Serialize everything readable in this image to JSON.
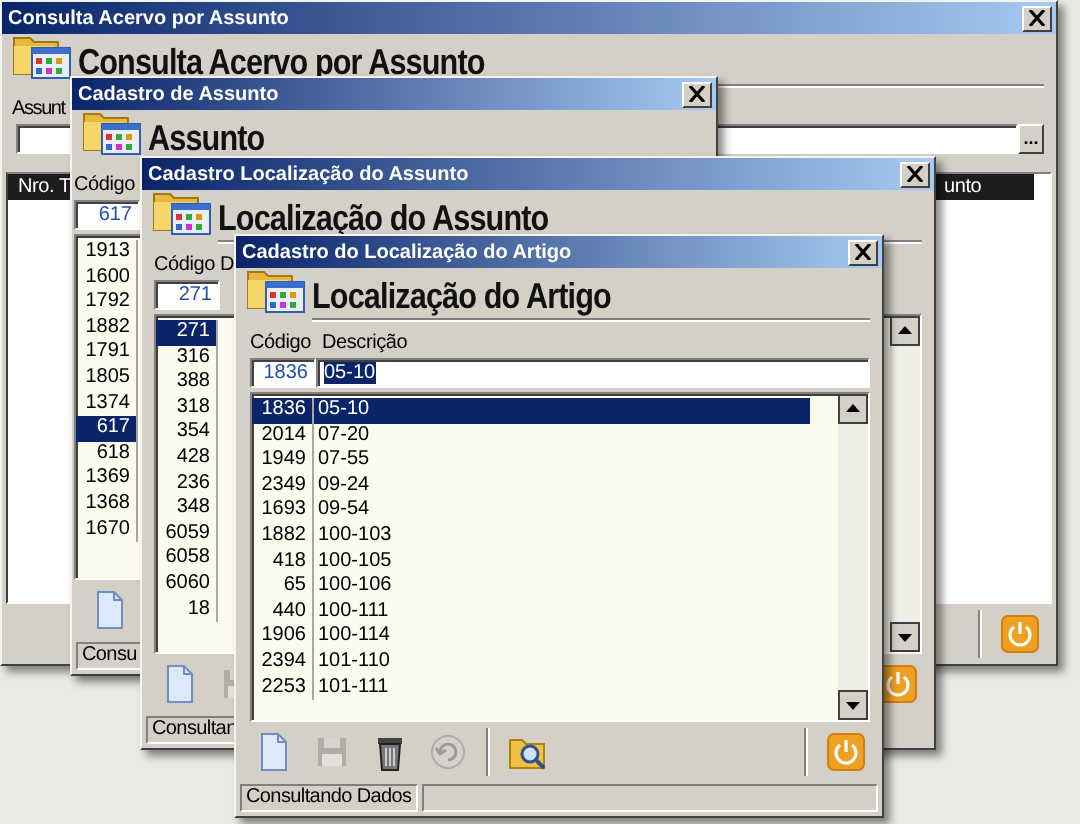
{
  "windows": [
    {
      "kind": "search",
      "title": "Consulta Acervo por Assunto",
      "heading": "Consulta Acervo por Assunto",
      "field_label": "Assunt",
      "ellipsis_button": "...",
      "grid_columns": [
        "Nro. T",
        "unto"
      ],
      "toolbar": {
        "end": [
          {
            "kind": "exit",
            "disabled": false
          }
        ]
      }
    },
    {
      "kind": "list",
      "title": "Cadastro de Assunto",
      "heading": "Assunto",
      "code_label": "Código",
      "code_value": "617",
      "rows": [
        {
          "code": "1913",
          "selected": false
        },
        {
          "code": "1600",
          "selected": false
        },
        {
          "code": "1792",
          "selected": false
        },
        {
          "code": "1882",
          "selected": false
        },
        {
          "code": "1791",
          "selected": false
        },
        {
          "code": "1805",
          "selected": false
        },
        {
          "code": "1374",
          "selected": false
        },
        {
          "code": "617",
          "selected": true
        },
        {
          "code": "618",
          "selected": false
        },
        {
          "code": "1369",
          "selected": false
        },
        {
          "code": "1368",
          "selected": false
        },
        {
          "code": "1670",
          "selected": false
        }
      ],
      "toolbar": {
        "start": [
          [
            {
              "kind": "new",
              "disabled": false
            }
          ]
        ]
      },
      "status": "Consu"
    },
    {
      "kind": "list",
      "title": "Cadastro Localização do Assunto",
      "heading": "Localização do Assunto",
      "code_label": "Código",
      "desc_label": "D",
      "code_value": "271",
      "rows": [
        {
          "code": "271",
          "selected": true
        },
        {
          "code": "316",
          "selected": false
        },
        {
          "code": "388",
          "selected": false
        },
        {
          "code": "318",
          "selected": false
        },
        {
          "code": "354",
          "selected": false
        },
        {
          "code": "428",
          "selected": false
        },
        {
          "code": "236",
          "selected": false
        },
        {
          "code": "348",
          "selected": false
        },
        {
          "code": "6059",
          "selected": false
        },
        {
          "code": "6058",
          "selected": false
        },
        {
          "code": "6060",
          "selected": false
        },
        {
          "code": "18",
          "selected": false
        }
      ],
      "toolbar": {
        "start": [
          [
            {
              "kind": "new",
              "disabled": false
            },
            {
              "kind": "save",
              "disabled": true
            }
          ]
        ],
        "end": [
          {
            "kind": "exit",
            "disabled": false
          }
        ]
      },
      "status": "Consultan"
    },
    {
      "kind": "detail",
      "title": "Cadastro do Localização do Artigo",
      "heading": "Localização do Artigo",
      "code_label": "Código",
      "desc_label": "Descrição",
      "code_value": "1836",
      "desc_value": "05-10",
      "rows": [
        {
          "code": "1836",
          "desc": "05-10",
          "selected": true
        },
        {
          "code": "2014",
          "desc": "07-20",
          "selected": false
        },
        {
          "code": "1949",
          "desc": "07-55",
          "selected": false
        },
        {
          "code": "2349",
          "desc": "09-24",
          "selected": false
        },
        {
          "code": "1693",
          "desc": "09-54",
          "selected": false
        },
        {
          "code": "1882",
          "desc": "100-103",
          "selected": false
        },
        {
          "code": "418",
          "desc": "100-105",
          "selected": false
        },
        {
          "code": "65",
          "desc": "100-106",
          "selected": false
        },
        {
          "code": "440",
          "desc": "100-111",
          "selected": false
        },
        {
          "code": "1906",
          "desc": "100-114",
          "selected": false
        },
        {
          "code": "2394",
          "desc": "101-110",
          "selected": false
        },
        {
          "code": "2253",
          "desc": "101-111",
          "selected": false
        }
      ],
      "toolbar": {
        "start": [
          [
            {
              "kind": "new",
              "disabled": false
            },
            {
              "kind": "save",
              "disabled": true
            },
            {
              "kind": "delete",
              "disabled": false
            },
            {
              "kind": "undo",
              "disabled": true
            }
          ],
          [
            {
              "kind": "search",
              "disabled": false
            }
          ]
        ],
        "end": [
          {
            "kind": "exit",
            "disabled": false
          }
        ]
      },
      "status": "Consultando Dados"
    }
  ]
}
